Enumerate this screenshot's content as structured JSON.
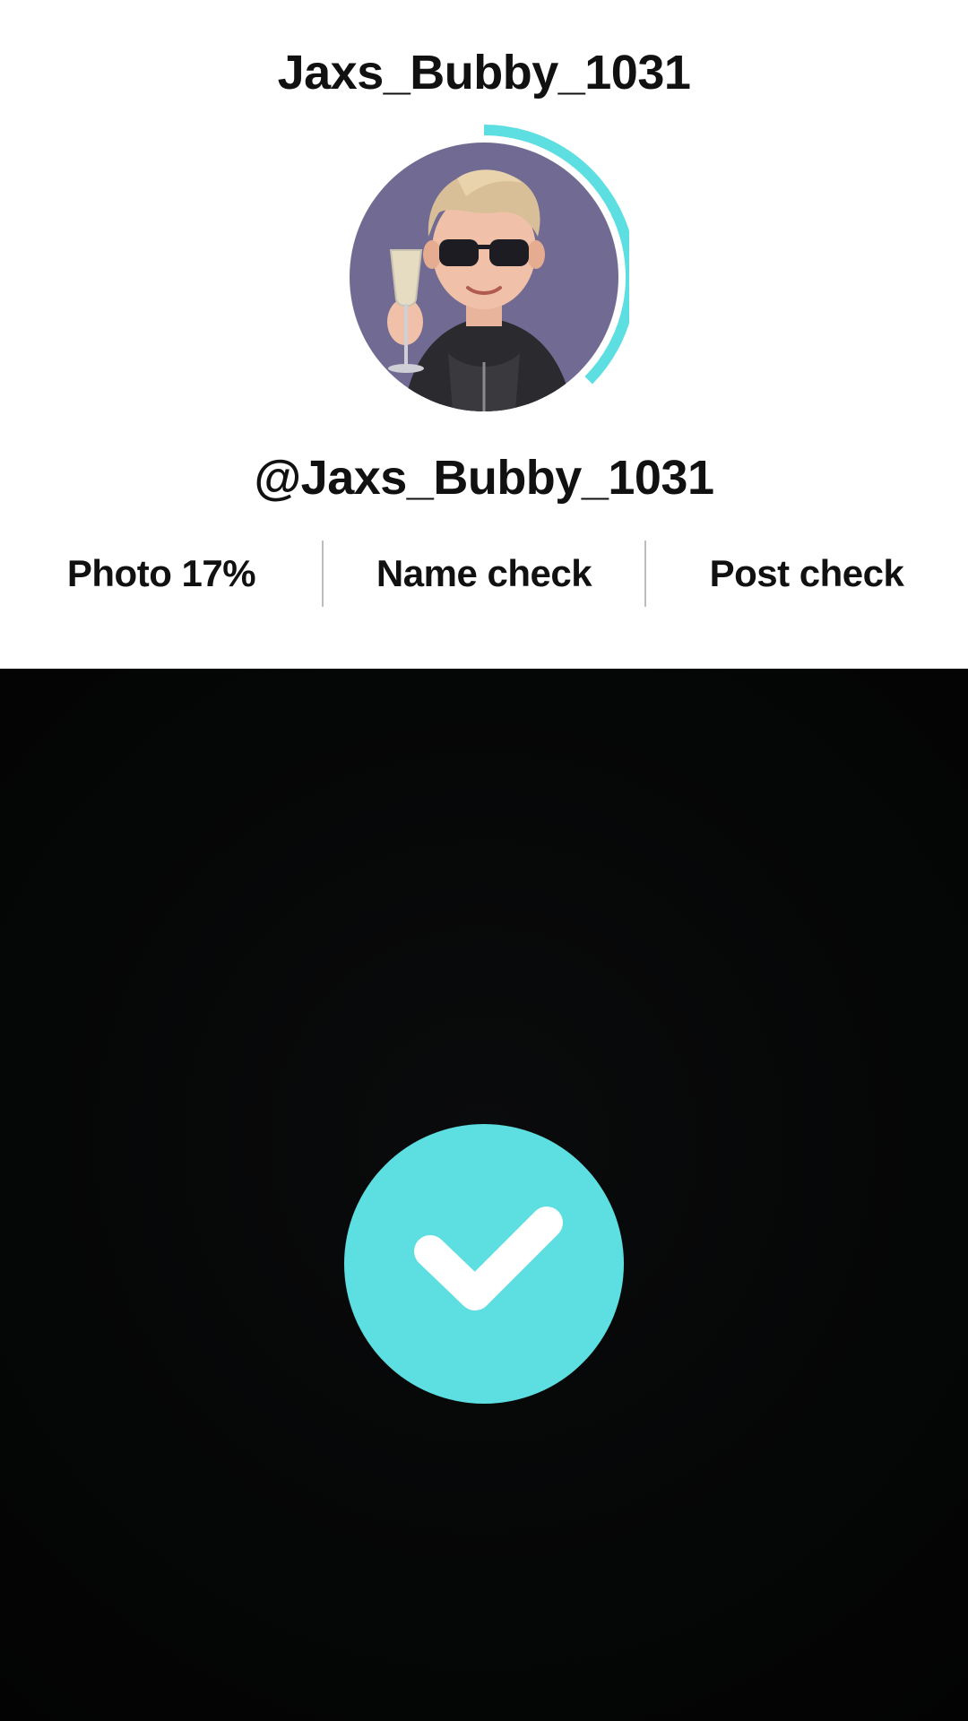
{
  "header": {
    "title": "Jaxs_Bubby_1031"
  },
  "profile": {
    "avatar_icon": "cartoon-avatar-with-sunglasses-and-glass",
    "handle": "@Jaxs_Bubby_1031",
    "photo_progress_fraction": 0.17
  },
  "checks": [
    {
      "label": "Photo 17%"
    },
    {
      "label": "Name check"
    },
    {
      "label": "Post check"
    }
  ],
  "status": {
    "icon": "checkmark-icon"
  },
  "colors": {
    "accent": "#5ddfe2",
    "panel": "#ffffff",
    "background": "#000000",
    "text": "#111111"
  }
}
